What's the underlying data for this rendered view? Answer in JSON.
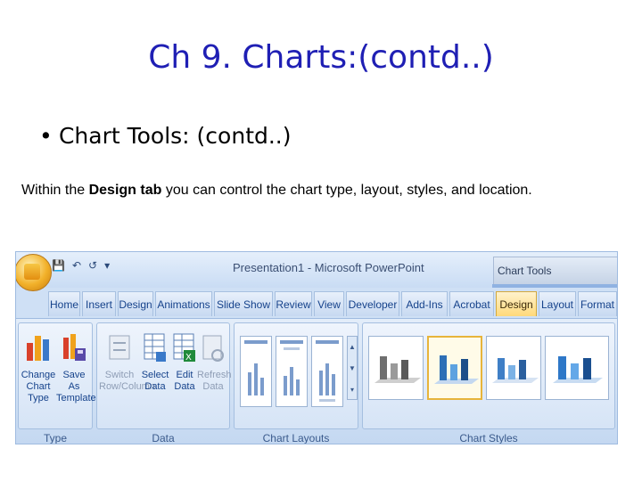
{
  "slide": {
    "title": "Ch 9. Charts:(contd..)",
    "bullet": "Chart Tools: (contd..)",
    "body_prefix": "Within the ",
    "body_bold": "Design tab",
    "body_suffix": " you can control the chart type, layout, styles, and location."
  },
  "ribbon": {
    "window_title": "Presentation1 - Microsoft PowerPoint",
    "context_tools": "Chart Tools",
    "tabs": [
      {
        "label": "Home"
      },
      {
        "label": "Insert"
      },
      {
        "label": "Design"
      },
      {
        "label": "Animations"
      },
      {
        "label": "Slide Show"
      },
      {
        "label": "Review"
      },
      {
        "label": "View"
      },
      {
        "label": "Developer"
      },
      {
        "label": "Add-Ins"
      },
      {
        "label": "Acrobat"
      },
      {
        "label": "Design",
        "active": true
      },
      {
        "label": "Layout"
      },
      {
        "label": "Format"
      }
    ],
    "groups": {
      "type": {
        "label": "Type",
        "commands": [
          {
            "line1": "Change",
            "line2": "Chart Type"
          },
          {
            "line1": "Save As",
            "line2": "Template"
          }
        ]
      },
      "data": {
        "label": "Data",
        "commands": [
          {
            "line1": "Switch",
            "line2": "Row/Column",
            "disabled": true
          },
          {
            "line1": "Select",
            "line2": "Data"
          },
          {
            "line1": "Edit",
            "line2": "Data"
          },
          {
            "line1": "Refresh",
            "line2": "Data",
            "disabled": true
          }
        ]
      },
      "chart_layouts": {
        "label": "Chart Layouts"
      },
      "chart_styles": {
        "label": "Chart Styles"
      }
    }
  },
  "colors": {
    "title": "#1f1fb4",
    "accent": "#e7b43b"
  }
}
